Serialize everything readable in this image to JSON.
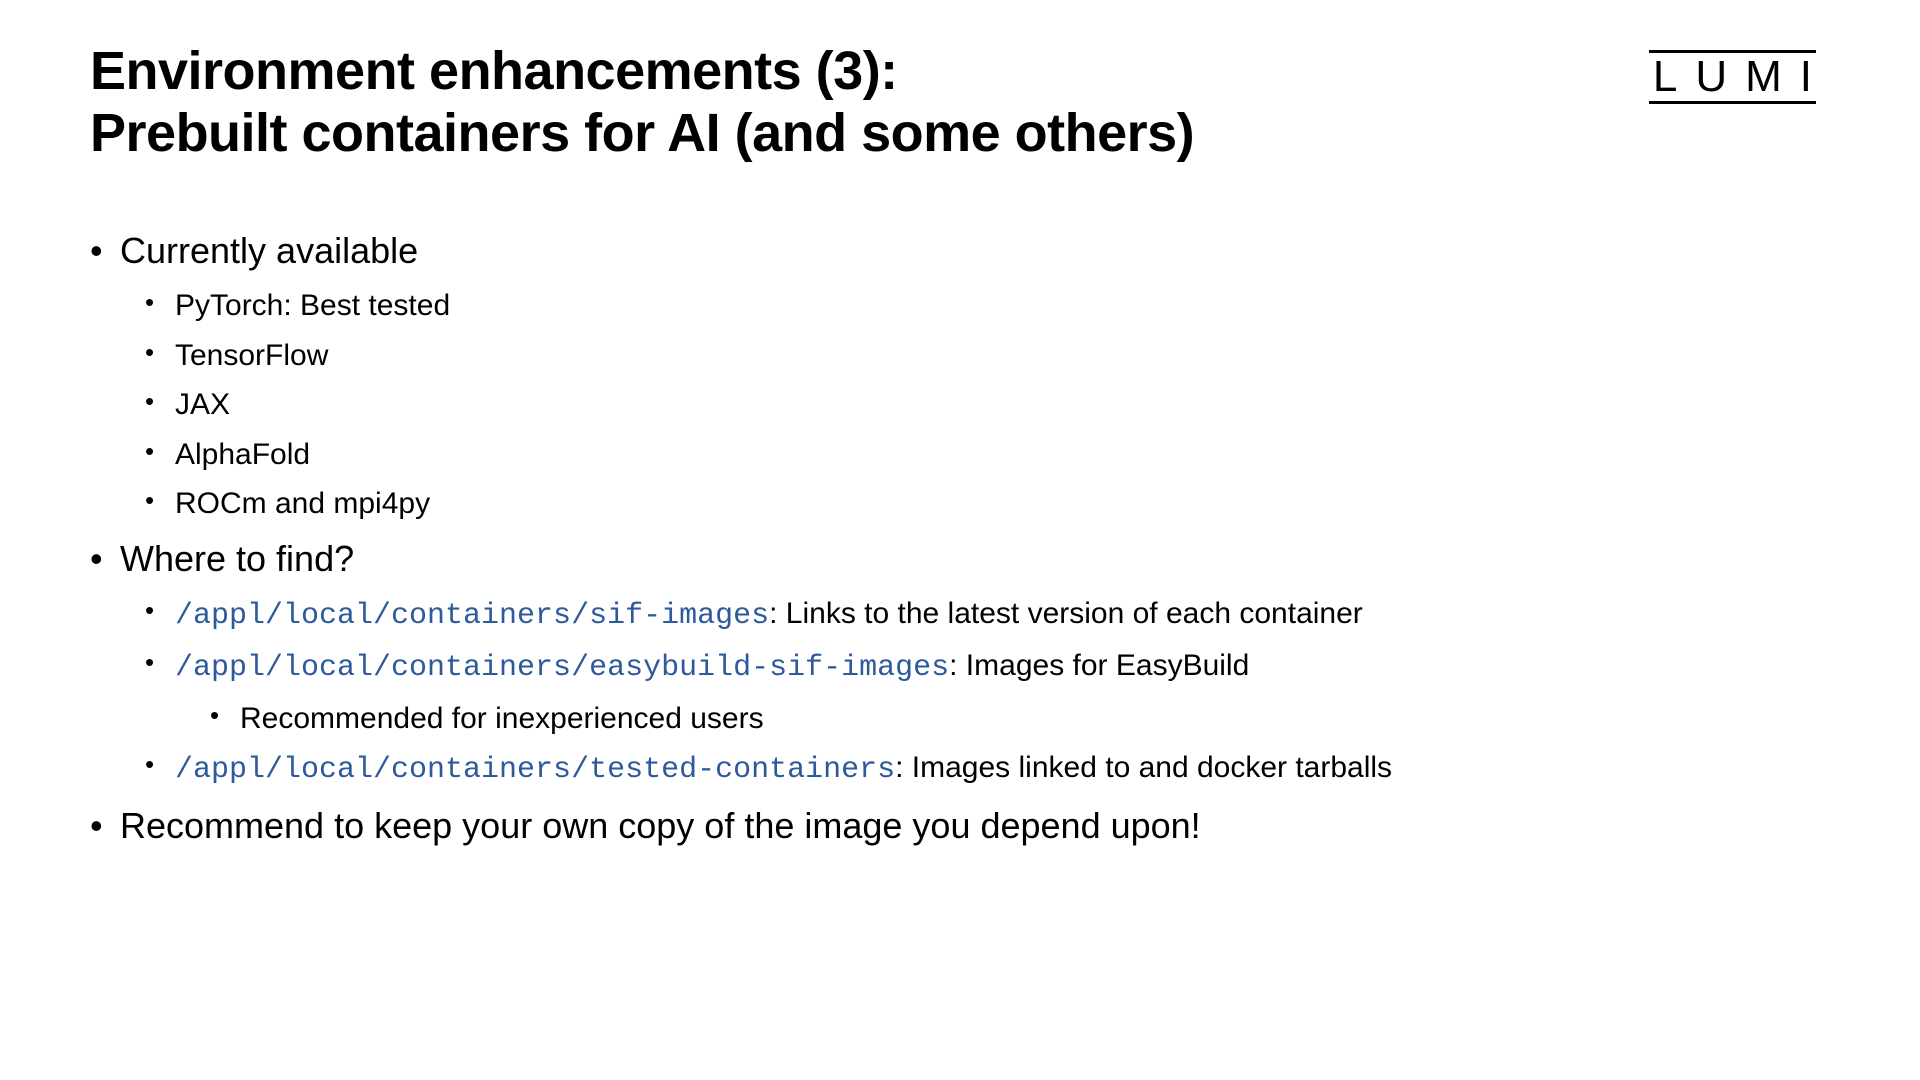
{
  "title": {
    "line1": "Environment enhancements (3):",
    "line2": "Prebuilt containers for AI (and some others)"
  },
  "logo": "LUMI",
  "bullets": {
    "b1": "Currently available",
    "b1_1": "PyTorch: Best tested",
    "b1_2": "TensorFlow",
    "b1_3": "JAX",
    "b1_4": "AlphaFold",
    "b1_5": "ROCm and mpi4py",
    "b2": "Where to find?",
    "b2_1_code": "/appl/local/containers/sif-images",
    "b2_1_text": ": Links to the latest version of each container",
    "b2_2_code": "/appl/local/containers/easybuild-sif-images",
    "b2_2_text": ": Images for EasyBuild",
    "b2_2_1": "Recommended for inexperienced users",
    "b2_3_code": "/appl/local/containers/tested-containers",
    "b2_3_text": ": Images linked to and docker tarballs",
    "b3": "Recommend to keep your own copy of the image you depend upon!"
  }
}
